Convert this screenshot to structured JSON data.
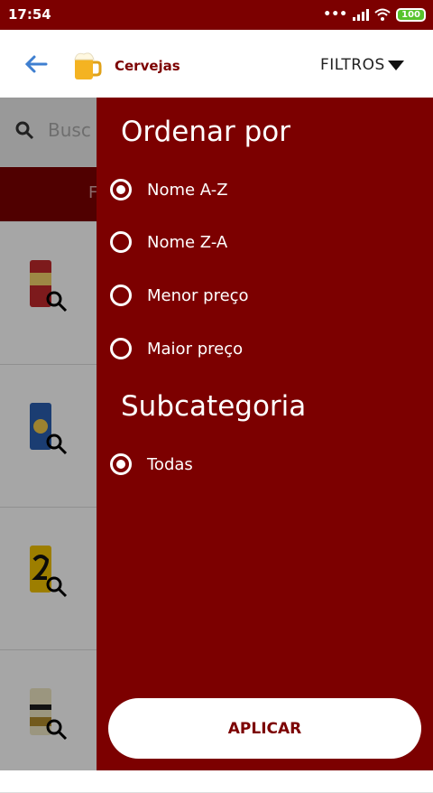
{
  "status": {
    "time": "17:54",
    "battery": "100"
  },
  "appbar": {
    "title": "Cervejas",
    "filters_label": "FILTROS"
  },
  "background": {
    "search_placeholder": "Busc",
    "filter_band_label": "F"
  },
  "drawer": {
    "sort_heading": "Ordenar por",
    "sort_options": [
      {
        "label": "Nome A-Z",
        "selected": true
      },
      {
        "label": "Nome Z-A",
        "selected": false
      },
      {
        "label": "Menor preço",
        "selected": false
      },
      {
        "label": "Maior preço",
        "selected": false
      }
    ],
    "sub_heading": "Subcategoria",
    "sub_options": [
      {
        "label": "Todas",
        "selected": true
      }
    ],
    "apply_label": "APLICAR"
  },
  "colors": {
    "brand": "#7c0000",
    "white": "#ffffff"
  }
}
